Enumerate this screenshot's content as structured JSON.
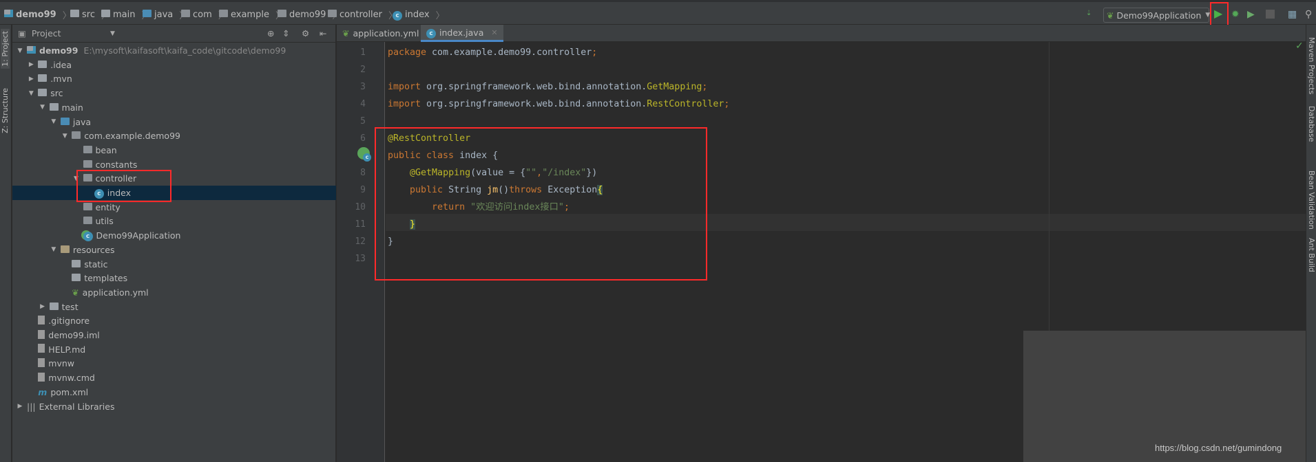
{
  "breadcrumb": [
    {
      "label": "demo99",
      "icon": "module"
    },
    {
      "label": "src",
      "icon": "folder"
    },
    {
      "label": "main",
      "icon": "folder"
    },
    {
      "label": "java",
      "icon": "source-folder"
    },
    {
      "label": "com",
      "icon": "package"
    },
    {
      "label": "example",
      "icon": "package"
    },
    {
      "label": "demo99",
      "icon": "package"
    },
    {
      "label": "controller",
      "icon": "package"
    },
    {
      "label": "index",
      "icon": "class"
    }
  ],
  "toolbar": {
    "run_config": "Demo99Application",
    "run_label": "Run",
    "debug_label": "Debug",
    "coverage_label": "Run with Coverage",
    "stop_label": "Stop"
  },
  "left_strip": {
    "project": "1: Project",
    "structure": "Z: Structure"
  },
  "project": {
    "title": "Project",
    "tree": [
      {
        "label": "demo99",
        "path": "E:\\mysoft\\kaifasoft\\kaifa_code\\gitcode\\demo99",
        "depth": 0,
        "arrow": "down",
        "icon": "module",
        "bold": true
      },
      {
        "label": ".idea",
        "depth": 1,
        "arrow": "right",
        "icon": "folder"
      },
      {
        "label": ".mvn",
        "depth": 1,
        "arrow": "right",
        "icon": "folder"
      },
      {
        "label": "src",
        "depth": 1,
        "arrow": "down",
        "icon": "folder"
      },
      {
        "label": "main",
        "depth": 2,
        "arrow": "down",
        "icon": "folder"
      },
      {
        "label": "java",
        "depth": 3,
        "arrow": "down",
        "icon": "source-folder"
      },
      {
        "label": "com.example.demo99",
        "depth": 4,
        "arrow": "down",
        "icon": "package"
      },
      {
        "label": "bean",
        "depth": 5,
        "icon": "package"
      },
      {
        "label": "constants",
        "depth": 5,
        "icon": "package"
      },
      {
        "label": "controller",
        "depth": 5,
        "arrow": "down",
        "icon": "package"
      },
      {
        "label": "index",
        "depth": 6,
        "icon": "class",
        "selected": true
      },
      {
        "label": "entity",
        "depth": 5,
        "icon": "package"
      },
      {
        "label": "utils",
        "depth": 5,
        "icon": "package"
      },
      {
        "label": "Demo99Application",
        "depth": 5,
        "icon": "spring-class"
      },
      {
        "label": "resources",
        "depth": 3,
        "arrow": "down",
        "icon": "resources-folder"
      },
      {
        "label": "static",
        "depth": 4,
        "icon": "folder"
      },
      {
        "label": "templates",
        "depth": 4,
        "icon": "folder"
      },
      {
        "label": "application.yml",
        "depth": 4,
        "icon": "spring-config"
      },
      {
        "label": "test",
        "depth": 2,
        "arrow": "right",
        "icon": "folder"
      },
      {
        "label": ".gitignore",
        "depth": 1,
        "icon": "file"
      },
      {
        "label": "demo99.iml",
        "depth": 1,
        "icon": "file"
      },
      {
        "label": "HELP.md",
        "depth": 1,
        "icon": "file"
      },
      {
        "label": "mvnw",
        "depth": 1,
        "icon": "file"
      },
      {
        "label": "mvnw.cmd",
        "depth": 1,
        "icon": "file"
      },
      {
        "label": "pom.xml",
        "depth": 1,
        "icon": "maven"
      },
      {
        "label": "External Libraries",
        "depth": 0,
        "arrow": "right",
        "icon": "libraries"
      }
    ]
  },
  "tabs": [
    {
      "label": "application.yml",
      "icon": "spring-config",
      "active": false
    },
    {
      "label": "index.java",
      "icon": "class",
      "active": true
    }
  ],
  "code": [
    [
      [
        "package",
        "kw"
      ],
      [
        " com.example.demo99.controller",
        ""
      ],
      [
        ";",
        "kw"
      ]
    ],
    [],
    [
      [
        "import",
        "kw"
      ],
      [
        " org.springframework.web.bind.annotation.",
        ""
      ],
      [
        "GetMapping",
        "ann"
      ],
      [
        ";",
        "kw"
      ]
    ],
    [
      [
        "import",
        "kw"
      ],
      [
        " org.springframework.web.bind.annotation.",
        ""
      ],
      [
        "RestController",
        "ann"
      ],
      [
        ";",
        "kw"
      ]
    ],
    [],
    [
      [
        "@RestController",
        "ann"
      ]
    ],
    [
      [
        "public class",
        "kw"
      ],
      [
        " index {",
        ""
      ]
    ],
    [
      [
        "    ",
        ""
      ],
      [
        "@GetMapping",
        "ann"
      ],
      [
        "(value = {",
        ""
      ],
      [
        "\"\"",
        "str"
      ],
      [
        ",",
        "kw"
      ],
      [
        "\"/index\"",
        "str"
      ],
      [
        "})",
        ""
      ]
    ],
    [
      [
        "    ",
        ""
      ],
      [
        "public",
        "kw"
      ],
      [
        " String ",
        ""
      ],
      [
        "jm",
        "fn"
      ],
      [
        "()",
        ""
      ],
      [
        "throws",
        "kw"
      ],
      [
        " Exception",
        ""
      ],
      [
        "{",
        "br"
      ]
    ],
    [
      [
        "        ",
        ""
      ],
      [
        "return",
        "kw"
      ],
      [
        " ",
        ""
      ],
      [
        "\"欢迎访问index接口\"",
        "str"
      ],
      [
        ";",
        "kw"
      ]
    ],
    [
      [
        "    ",
        ""
      ],
      [
        "}",
        "br"
      ]
    ],
    [
      [
        "}",
        ""
      ]
    ],
    []
  ],
  "right_strip": [
    "Maven Projects",
    "Database",
    "Bean Validation",
    "Ant Build"
  ],
  "watermark": "https://blog.csdn.net/gumindong"
}
